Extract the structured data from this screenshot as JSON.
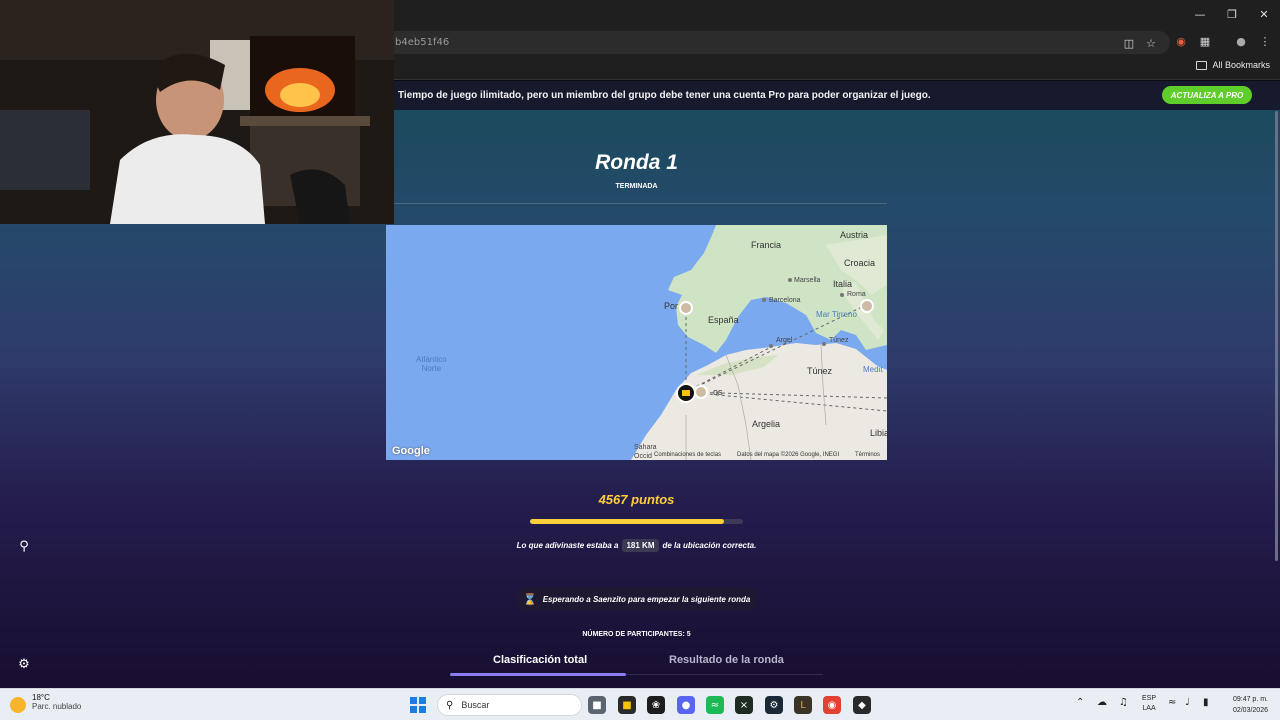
{
  "browser": {
    "url": "b4eb51f46",
    "bookmarks_label": "All Bookmarks",
    "window_controls": [
      "minimize-icon",
      "restore-icon",
      "close-icon"
    ]
  },
  "banner": {
    "message": "Tiempo de juego ilimitado, pero un miembro del grupo debe tener una cuenta Pro para poder organizar el juego.",
    "pro_button": "ACTUALIZA A PRO"
  },
  "round": {
    "title": "Ronda 1",
    "status": "TERMINADA"
  },
  "map": {
    "labels": {
      "francia": "Francia",
      "austria": "Austria",
      "croacia": "Croacia",
      "marsella": "Marsella",
      "italia": "Italia",
      "roma": "Roma",
      "barcelona": "Barcelona",
      "portugal": "Por   al",
      "espana": "España",
      "mar_tirreno": "Mar Tirreno",
      "argel": "Argel",
      "tunez_city": "Túnez",
      "tunez_country": "Túnez",
      "atlantico": "Atlántico\nNorte",
      "marruecos_partial": "os",
      "argelia": "Argelia",
      "libia": "Libia",
      "sahara": "Sahara\nOccid",
      "medit": "Medit"
    },
    "attribution": {
      "logo": "Google",
      "shortcuts": "Combinaciones de teclas",
      "data": "Datos del mapa ©2026 Google, INEGI",
      "terms": "Términos"
    }
  },
  "result": {
    "points_label": "4567 puntos",
    "score_fraction": 0.913,
    "distance_prefix": "Lo que adivinaste estaba a",
    "distance_value": "181 KM",
    "distance_suffix": "de la ubicación correcta."
  },
  "waiting": {
    "text": "Esperando a Saenzito para empezar la siguiente ronda"
  },
  "participants": {
    "label": "NÚMERO DE PARTICIPANTES: 5"
  },
  "tabs": [
    {
      "label": "Clasificación total",
      "active": true
    },
    {
      "label": "Resultado de la ronda",
      "active": false
    }
  ],
  "taskbar": {
    "weather_temp": "18°C",
    "weather_desc": "Parc. nublado",
    "search_label": "Buscar",
    "lang_line1": "ESP",
    "lang_line2": "LAA",
    "time": "09:47 p. m.",
    "date": "02/03/2026"
  },
  "colors": {
    "accent_gold": "#ffcf3a",
    "pro_green": "#5fcd2a",
    "tab_underline": "#8b7cf2"
  }
}
